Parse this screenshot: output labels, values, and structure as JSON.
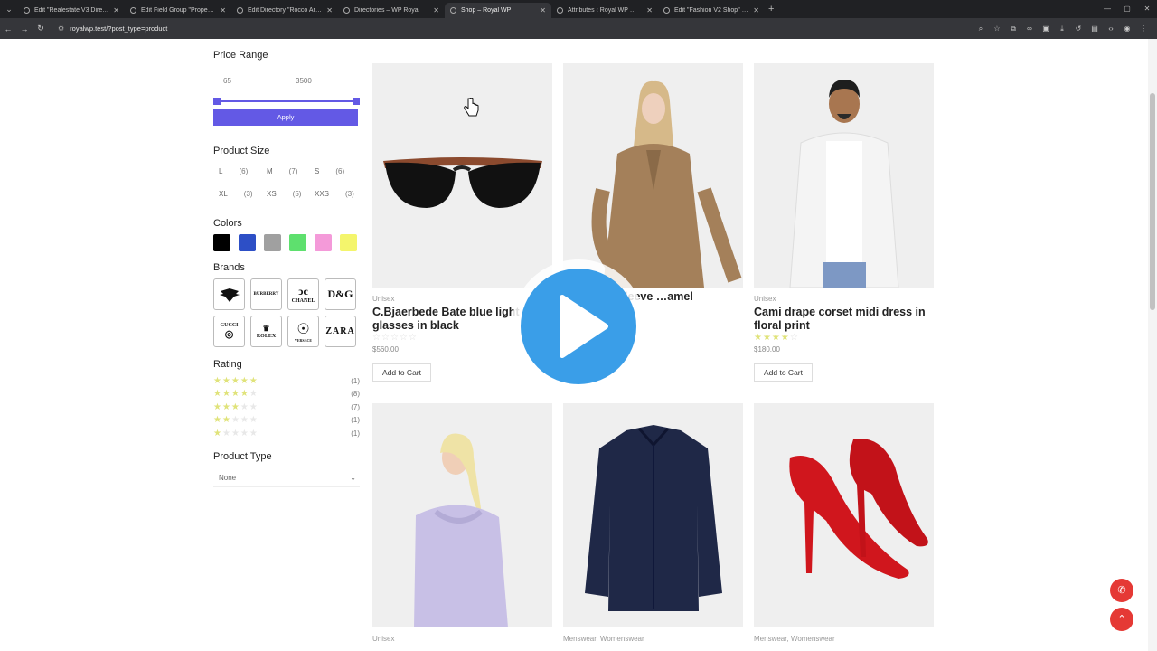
{
  "browser": {
    "tabs": [
      {
        "title": "Edit \"Realestate V3 Directory\" ·",
        "active": false
      },
      {
        "title": "Edit Field Group \"Property Deta",
        "active": false
      },
      {
        "title": "Edit Directory \"Rocco Arquitecte",
        "active": false
      },
      {
        "title": "Directories – WP Royal",
        "active": false
      },
      {
        "title": "Shop – Royal WP",
        "active": true
      },
      {
        "title": "Attributes ‹ Royal WP — WordP",
        "active": false
      },
      {
        "title": "Edit \"Fashion V2 Shop\" with Ele",
        "active": false
      }
    ],
    "url": "royalwp.test/?post_type=product"
  },
  "filters": {
    "price_range": {
      "title": "Price Range",
      "min": "65",
      "max": "3500",
      "apply_label": "Apply",
      "accent": "#6359e5"
    },
    "product_size": {
      "title": "Product Size",
      "sizes": [
        {
          "label": "L",
          "count": "(6)"
        },
        {
          "label": "M",
          "count": "(7)"
        },
        {
          "label": "S",
          "count": "(6)"
        },
        {
          "label": "XL",
          "count": "(3)"
        },
        {
          "label": "XS",
          "count": "(5)"
        },
        {
          "label": "XXS",
          "count": "(3)"
        }
      ]
    },
    "colors": {
      "title": "Colors",
      "swatches": [
        "#000000",
        "#2d4fc6",
        "#a0a0a0",
        "#5ee06e",
        "#f49ad9",
        "#f4f56c"
      ]
    },
    "brands": {
      "title": "Brands",
      "logos": [
        "EMPORIO ARMANI",
        "BURBERRY",
        "CHANEL",
        "D&G",
        "GUCCI",
        "ROLEX",
        "VERSACE",
        "ZARA"
      ]
    },
    "rating": {
      "title": "Rating",
      "rows": [
        {
          "stars": 5,
          "count": "(1)"
        },
        {
          "stars": 4,
          "count": "(8)"
        },
        {
          "stars": 3,
          "count": "(7)"
        },
        {
          "stars": 2,
          "count": "(1)"
        },
        {
          "stars": 1,
          "count": "(1)"
        }
      ]
    },
    "product_type": {
      "title": "Product Type",
      "selected": "None"
    }
  },
  "products": [
    {
      "category": "Unisex",
      "title": "C.Bjaerbede Bate blue light glasses in black",
      "rating": 0,
      "price": "$560.00",
      "cart_label": "Add to Cart",
      "image": "sunglasses"
    },
    {
      "category": "",
      "title": "…out one sleeve …amel",
      "rating": 0,
      "price": "",
      "cart_label": "",
      "image": "woman-blazer"
    },
    {
      "category": "Unisex",
      "title": "Cami drape corset midi dress in floral print",
      "rating": 4,
      "price": "$180.00",
      "cart_label": "Add to Cart",
      "image": "man-white-shirt"
    },
    {
      "category": "Unisex",
      "title": "",
      "rating": 0,
      "price": "",
      "cart_label": "",
      "image": "woman-hoodie"
    },
    {
      "category": "Menswear, Womenswear",
      "title": "",
      "rating": 0,
      "price": "",
      "cart_label": "",
      "image": "navy-shirt"
    },
    {
      "category": "Menswear, Womenswear",
      "title": "",
      "rating": 0,
      "price": "",
      "cart_label": "",
      "image": "red-heels"
    }
  ],
  "overlay": {
    "play_icon": "play-icon",
    "play_color": "#3a9ee8"
  },
  "floating": {
    "call_icon": "phone-icon",
    "top_icon": "chevron-up-icon",
    "color": "#e53935"
  }
}
